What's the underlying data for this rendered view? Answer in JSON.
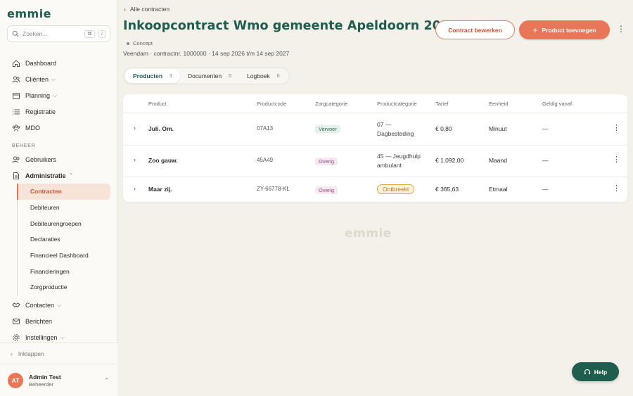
{
  "app": {
    "logo": "emmie"
  },
  "search": {
    "placeholder": "Zoeken...",
    "shortcut_1": "⌘",
    "shortcut_2": "/"
  },
  "sidebar": {
    "items": [
      {
        "label": "Dashboard",
        "icon": "home-icon"
      },
      {
        "label": "Cliënten",
        "icon": "users-icon"
      },
      {
        "label": "Planning",
        "icon": "calendar-icon"
      },
      {
        "label": "Registratie",
        "icon": "list-icon"
      },
      {
        "label": "MDO",
        "icon": "team-icon"
      }
    ],
    "section_beheer": "BEHEER",
    "beheer_items": [
      {
        "label": "Gebruikers",
        "icon": "users-icon"
      },
      {
        "label": "Administratie",
        "icon": "document-icon"
      }
    ],
    "admin_sub": [
      "Contracten",
      "Debiteuren",
      "Debiteurengroepen",
      "Declaraties",
      "Financieel Dashboard",
      "Financieringen",
      "Zorgproductie"
    ],
    "after_items": [
      {
        "label": "Contacten",
        "icon": "handshake-icon"
      },
      {
        "label": "Berichten",
        "icon": "mail-icon"
      },
      {
        "label": "Instellingen",
        "icon": "gear-icon"
      }
    ],
    "collapse_label": "Inklappen",
    "user": {
      "initials": "AT",
      "name": "Admin Test",
      "role": "Beheerder"
    }
  },
  "header": {
    "back_label": "Alle contracten",
    "title": "Inkoopcontract Wmo gemeente Apeldoorn 2025",
    "status": "Concept",
    "meta": "Veendam · contractnr. 1000000 · 14 sep 2026 t/m 14 sep 2027",
    "edit_button": "Contract bewerken",
    "add_button": "Product toevoegen"
  },
  "tabs": [
    {
      "label": "Producten",
      "count": "3"
    },
    {
      "label": "Documenten",
      "count": "0"
    },
    {
      "label": "Logboek",
      "count": "0"
    }
  ],
  "table": {
    "headers": [
      "Product",
      "Productcode",
      "Zorgcategorie",
      "Productcategorie",
      "Tarief",
      "Eenheid",
      "Geldig vanaf"
    ],
    "rows": [
      {
        "product": "Juli. Om.",
        "code": "07A13",
        "zorgcategorie": "Vervoer",
        "productcategorie": "07 — Dagbesteding",
        "tarief": "€ 0,80",
        "eenheid": "Minuut",
        "geldig": "—"
      },
      {
        "product": "Zoo gauw.",
        "code": "45A49",
        "zorgcategorie": "Overig",
        "productcategorie": "45 — Jeugdhulp ambulant",
        "tarief": "€ 1.092,00",
        "eenheid": "Maand",
        "geldig": "—"
      },
      {
        "product": "Maar zij.",
        "code": "ZY-66778-KL",
        "zorgcategorie": "Overig",
        "productcategorie": "Ontbreekt",
        "tarief": "€ 365,63",
        "eenheid": "Etmaal",
        "geldig": "—"
      }
    ]
  },
  "watermark": "emmie",
  "help_label": "Help",
  "colors": {
    "brand": "#1f5d4e",
    "accent": "#e8775a",
    "background": "#f3f1ea"
  }
}
